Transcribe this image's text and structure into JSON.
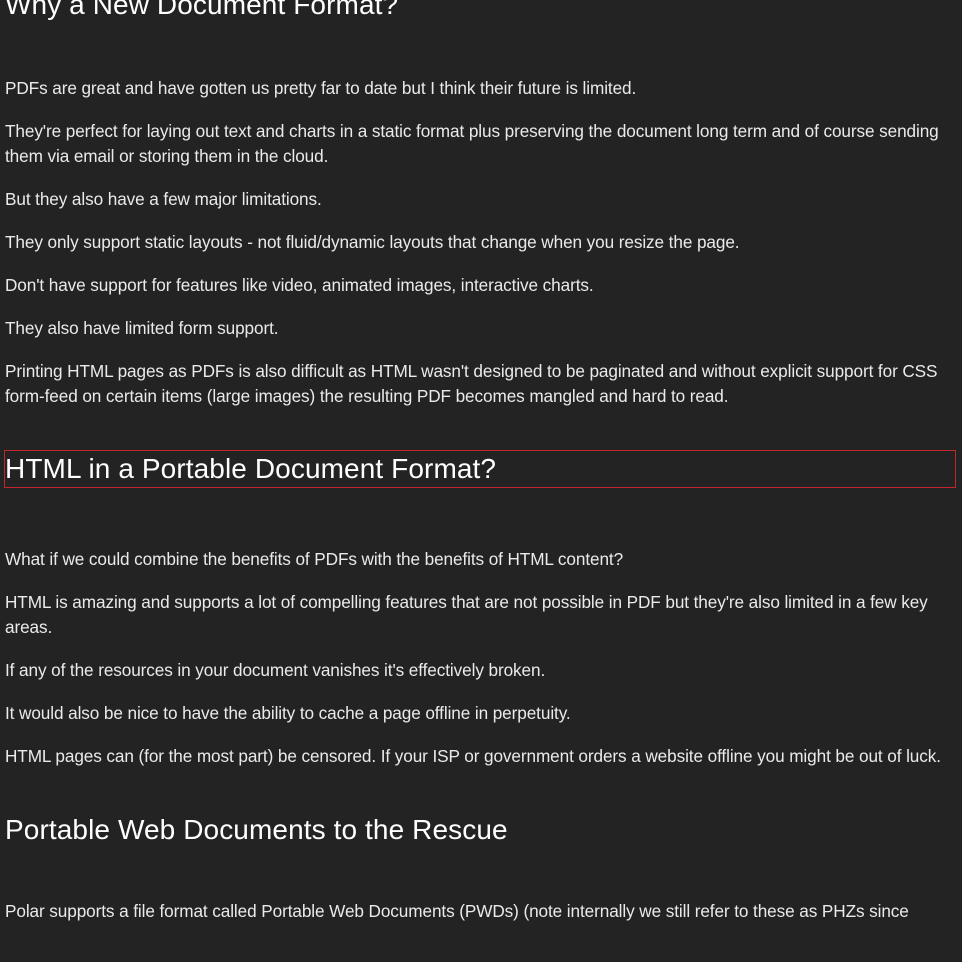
{
  "sections": [
    {
      "heading": "Why a New Document Format?",
      "paragraphs": [
        "PDFs are great and have gotten us pretty far to date but I think their future is limited.",
        "They're perfect for laying out text and charts in a static format plus preserving the document long term and of course sending them via email or storing them in the cloud.",
        "But they also have a few major limitations.",
        "They only support static layouts - not fluid/dynamic layouts that change when you resize the page.",
        "Don't have support for features like video, animated images, interactive charts.",
        "They also have limited form support.",
        "Printing HTML pages as PDFs is also difficult as HTML wasn't designed to be paginated and without explicit support for CSS form-feed on certain items (large images) the resulting PDF becomes mangled and hard to read."
      ]
    },
    {
      "heading": "HTML in a Portable Document Format?",
      "paragraphs": [
        "What if we could combine the benefits of PDFs with the benefits of HTML content?",
        "HTML is amazing and supports a lot of compelling features that are not possible in PDF but they're also limited in a few key areas.",
        "If any of the resources in your document vanishes it's effectively broken.",
        "It would also be nice to have the ability to cache a page offline in perpetuity.",
        "HTML pages can (for the most part) be censored. If your ISP or government orders a website offline you might be out of luck."
      ]
    },
    {
      "heading": "Portable Web Documents to the Rescue",
      "paragraphs": [
        "Polar supports a file format called Portable Web Documents (PWDs) (note internally we still refer to these as PHZs since"
      ]
    }
  ]
}
